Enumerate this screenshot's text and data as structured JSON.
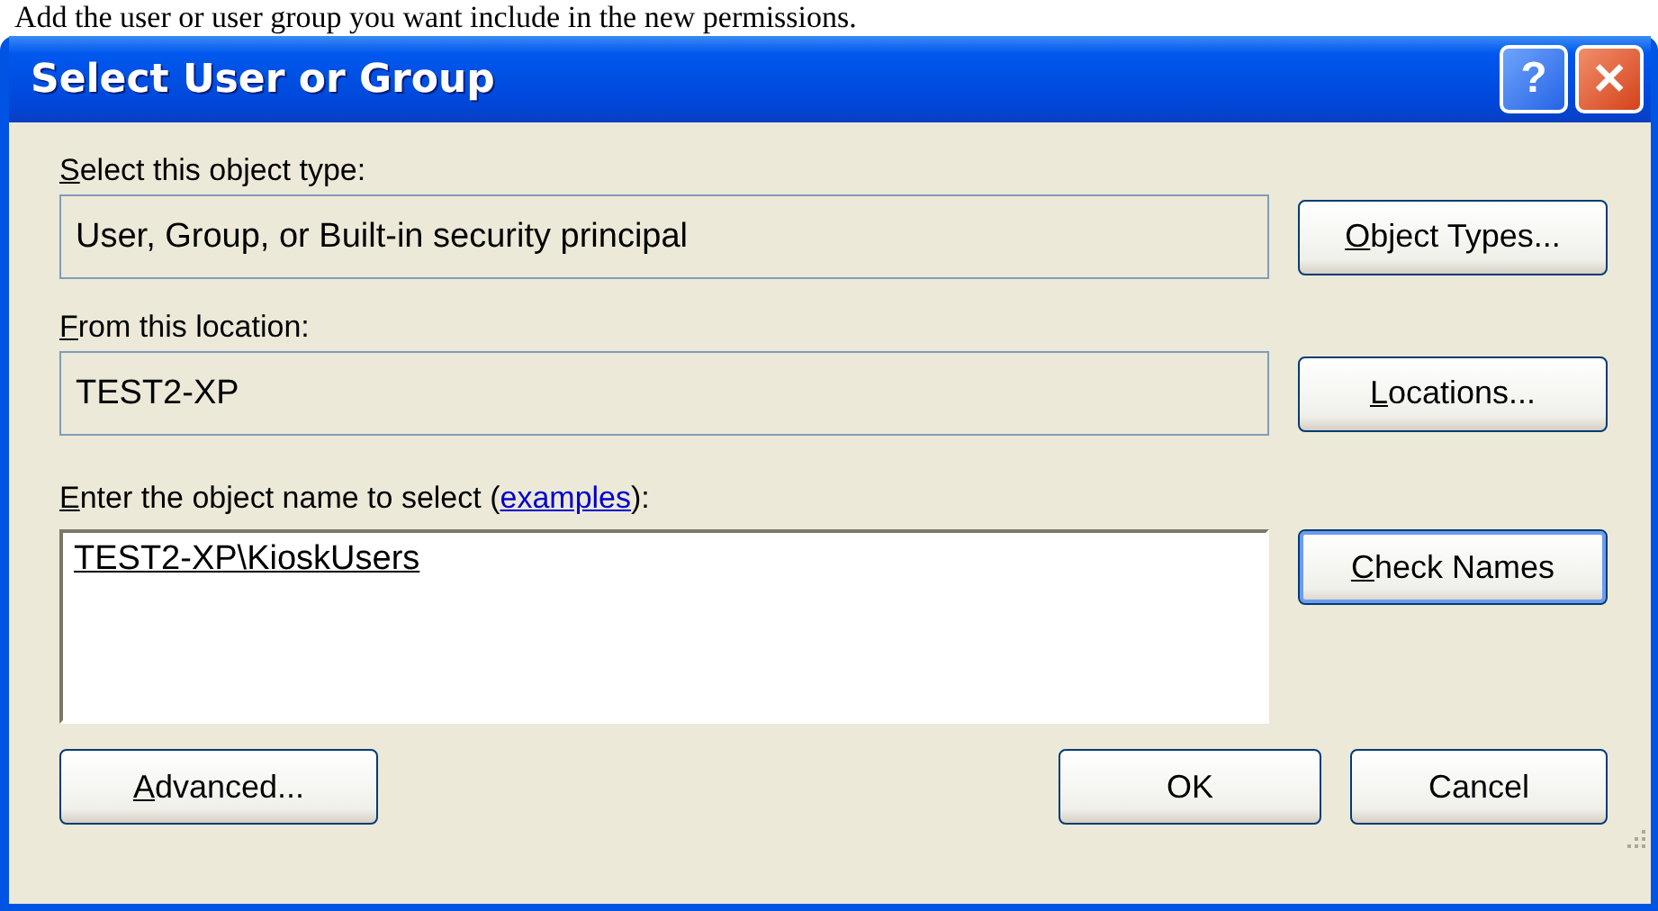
{
  "caption": "Add the user or user group you want include in the new permissions.",
  "window": {
    "title": "Select User or Group",
    "controls": [
      {
        "kind": "help",
        "label": "?"
      },
      {
        "kind": "close",
        "label": "✕"
      }
    ]
  },
  "rows": [
    {
      "label": {
        "key": "S",
        "rest": "elect this object type:"
      },
      "field": {
        "value": "User, Group, or Built-in security principal"
      },
      "button": {
        "key": "O",
        "rest": "bject Types...",
        "default": false
      }
    },
    {
      "label": {
        "key": "F",
        "rest": "rom this location:"
      },
      "field": {
        "value": "TEST2-XP"
      },
      "button": {
        "key": "L",
        "rest": "ocations...",
        "default": false
      }
    }
  ],
  "name_entry": {
    "label": {
      "key": "E",
      "before": "nter the object name to select (",
      "link": "examples",
      "after": "):"
    },
    "value": "TEST2-XP\\KioskUsers",
    "button": {
      "key": "C",
      "rest": "heck Names",
      "default": true
    }
  },
  "footer": {
    "advanced": {
      "key": "A",
      "rest": "dvanced..."
    },
    "ok": {
      "label": "OK"
    },
    "cancel": {
      "label": "Cancel"
    }
  }
}
